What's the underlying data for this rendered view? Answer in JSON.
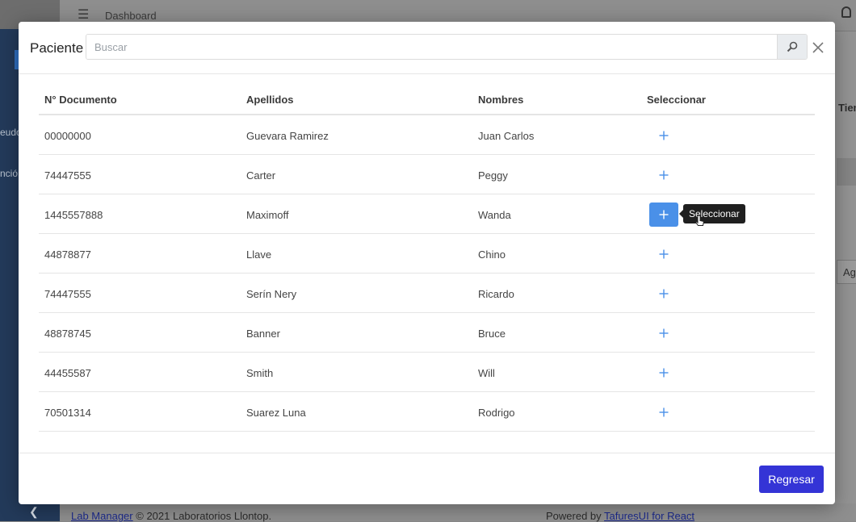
{
  "background": {
    "topbar": {
      "title": "Dashboard"
    },
    "sidebar": {
      "items": [
        "eudo",
        "nció"
      ]
    },
    "right_column_label": "Tiem",
    "right_button_label": "Ag",
    "footer": {
      "app_link": "Lab Manager",
      "copyright": "© 2021 Laboratorios Llontop.",
      "powered_prefix": "Powered by",
      "powered_link": "TafuresUI for React"
    }
  },
  "modal": {
    "title": "Paciente",
    "search": {
      "placeholder": "Buscar",
      "value": ""
    },
    "headers": [
      "N° Documento",
      "Apellidos",
      "Nombres",
      "Seleccionar"
    ],
    "rows": [
      {
        "documento": "00000000",
        "apellidos": "Guevara Ramirez",
        "nombres": "Juan Carlos"
      },
      {
        "documento": "74447555",
        "apellidos": "Carter",
        "nombres": "Peggy"
      },
      {
        "documento": "1445557888",
        "apellidos": "Maximoff",
        "nombres": "Wanda"
      },
      {
        "documento": "44878877",
        "apellidos": "Llave",
        "nombres": "Chino"
      },
      {
        "documento": "74447555",
        "apellidos": "Serín Nery",
        "nombres": "Ricardo"
      },
      {
        "documento": "48878745",
        "apellidos": "Banner",
        "nombres": "Bruce"
      },
      {
        "documento": "44455587",
        "apellidos": "Smith",
        "nombres": "Will"
      },
      {
        "documento": "70501314",
        "apellidos": "Suarez Luna",
        "nombres": "Rodrigo"
      }
    ],
    "select_icon": "plus-icon",
    "hovered_row": 3,
    "tooltip": "Seleccionar",
    "back_button": "Regresar"
  },
  "colors": {
    "primary_button": "#3434d6",
    "select_active": "#4a90e8",
    "select_icon": "#4a90e8",
    "tooltip_bg": "#1f1f1f"
  }
}
